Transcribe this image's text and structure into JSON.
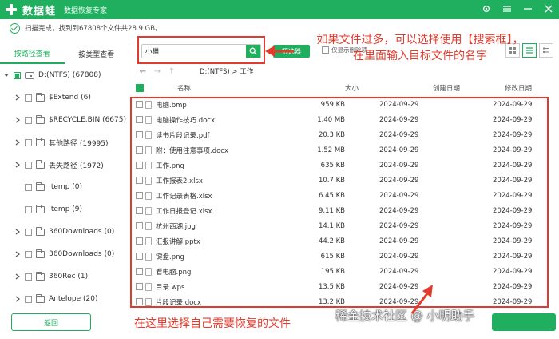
{
  "app": {
    "name": "数据蛙",
    "subtitle": "数据恢复专家"
  },
  "status": {
    "text": "扫描完成，找到到67808个文件共28.9 GB。"
  },
  "tabs": [
    {
      "label": "按路径查看",
      "active": true
    },
    {
      "label": "按类型查看",
      "active": false
    }
  ],
  "tree": {
    "root": "D:(NTFS) (67808)",
    "items": [
      {
        "label": "$Extend (6)",
        "icon": "folder-icon"
      },
      {
        "label": "$RECYCLE.BIN (6675)",
        "icon": "folder-icon"
      },
      {
        "label": "其他路径 (19995)",
        "icon": "folder-icon"
      },
      {
        "label": "丢失路径 (1972)",
        "icon": "folder-icon"
      },
      {
        "label": ".temp (0)",
        "icon": "folder-icon"
      },
      {
        "label": ".temp (9)",
        "icon": "folder-icon"
      },
      {
        "label": "360Downloads (0)",
        "icon": "folder-icon"
      },
      {
        "label": "360Downloads (0)",
        "icon": "folder-icon"
      },
      {
        "label": "360Rec (1)",
        "icon": "folder-icon"
      },
      {
        "label": "Antelope (20)",
        "icon": "folder-icon"
      }
    ]
  },
  "back_label": "返回",
  "search": {
    "value": "小猫"
  },
  "filter_label": "筛选器",
  "deleted_only_label": "仅显示删除项",
  "path": "D:(NTFS) > 工作",
  "columns": {
    "name": "名称",
    "size": "大小",
    "created": "创建日期",
    "modified": "修改日期"
  },
  "files": [
    {
      "name": "电脑.bmp",
      "size": "959 KB",
      "created": "2024-09-29",
      "modified": "2024-09-29"
    },
    {
      "name": "电脑操作技巧.docx",
      "size": "1.40 MB",
      "created": "2024-09-29",
      "modified": "2024-09-29"
    },
    {
      "name": "读书片段记录.pdf",
      "size": "20.3 KB",
      "created": "2024-09-29",
      "modified": "2024-09-29"
    },
    {
      "name": "附：使用注意事项.docx",
      "size": "1.52 MB",
      "created": "2024-09-29",
      "modified": "2024-09-29"
    },
    {
      "name": "工作.png",
      "size": "635 KB",
      "created": "2024-09-29",
      "modified": "2024-09-29"
    },
    {
      "name": "工作报表2.xlsx",
      "size": "10.7 KB",
      "created": "2024-09-29",
      "modified": "2024-09-29"
    },
    {
      "name": "工作记录表格.xlsx",
      "size": "6.45 KB",
      "created": "2024-09-29",
      "modified": "2024-09-29"
    },
    {
      "name": "工作日报登记.xlsx",
      "size": "9.11 KB",
      "created": "2024-09-29",
      "modified": "2024-09-29"
    },
    {
      "name": "杭州西湖.jpg",
      "size": "14.1 KB",
      "created": "2024-09-29",
      "modified": "2024-09-29"
    },
    {
      "name": "汇报讲解.pptx",
      "size": "44.2 KB",
      "created": "2024-09-29",
      "modified": "2024-09-29"
    },
    {
      "name": "键盘.png",
      "size": "615 KB",
      "created": "2024-09-29",
      "modified": "2024-09-29"
    },
    {
      "name": "看电脑.png",
      "size": "195 KB",
      "created": "2024-09-29",
      "modified": "2024-09-29"
    },
    {
      "name": "目录.wps",
      "size": "13.5 KB",
      "created": "2024-09-29",
      "modified": "2024-09-29"
    },
    {
      "name": "片段记录.docx",
      "size": "13.2 KB",
      "created": "2024-09-29",
      "modified": "2024-09-29"
    }
  ],
  "annotations": {
    "top_line1": "如果文件过多，可以选择使用【搜索框】，",
    "top_line2": "在里面输入目标文件的名字",
    "bottom": "在这里选择自己需要恢复的文件"
  },
  "watermark": "稀金技术社区 @ 小明助手",
  "colors": {
    "brand": "#1faf5f",
    "annotation": "#e23b2e"
  }
}
